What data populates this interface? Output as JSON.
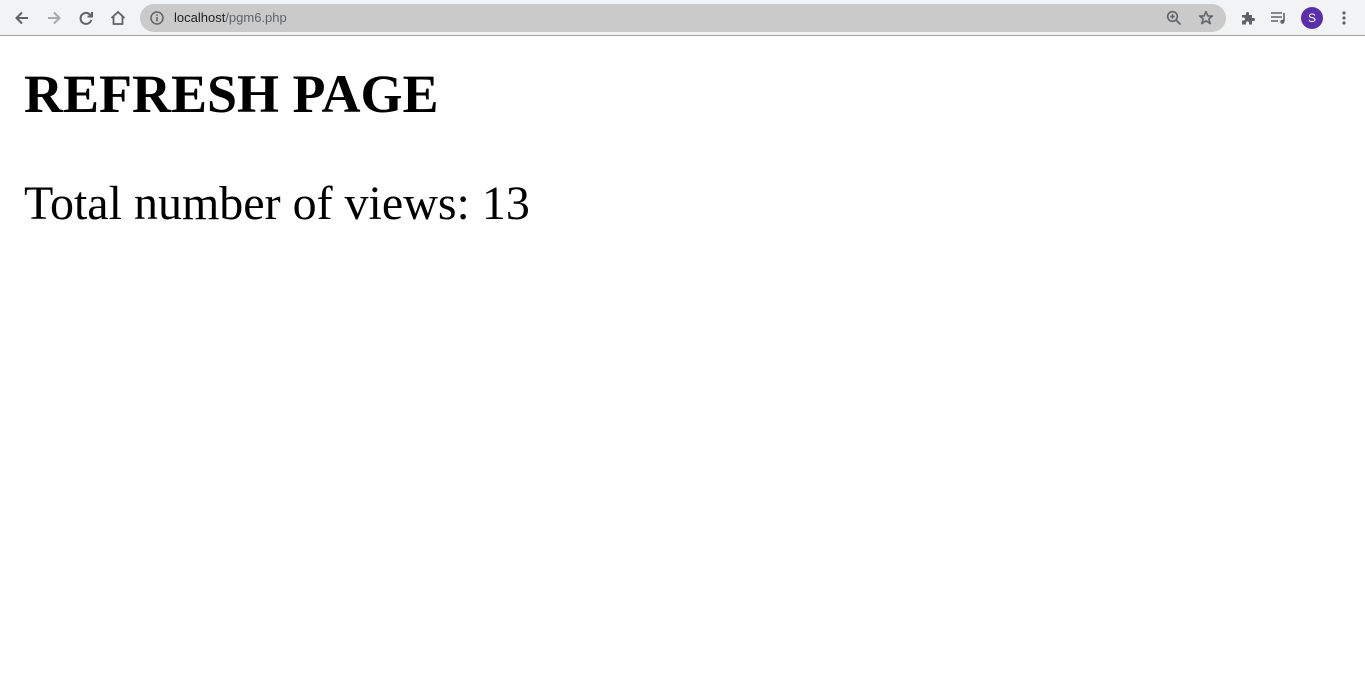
{
  "browser": {
    "url_host": "localhost",
    "url_path": "/pgm6.php",
    "profile_initial": "S",
    "icons": {
      "back": "arrow-left-icon",
      "forward": "arrow-right-icon",
      "reload": "reload-icon",
      "home": "home-icon",
      "site_info": "info-icon",
      "zoom": "zoom-in-icon",
      "bookmark": "star-icon",
      "extensions": "puzzle-icon",
      "media": "playlist-icon",
      "menu": "kebab-menu-icon"
    },
    "colors": {
      "toolbar_bg": "#f1f3f4",
      "omnibox_bg": "#cacaca",
      "avatar_bg": "#5b2fa8"
    }
  },
  "page": {
    "heading": "REFRESH PAGE",
    "views_label": "Total number of views: ",
    "views_count": "13"
  }
}
